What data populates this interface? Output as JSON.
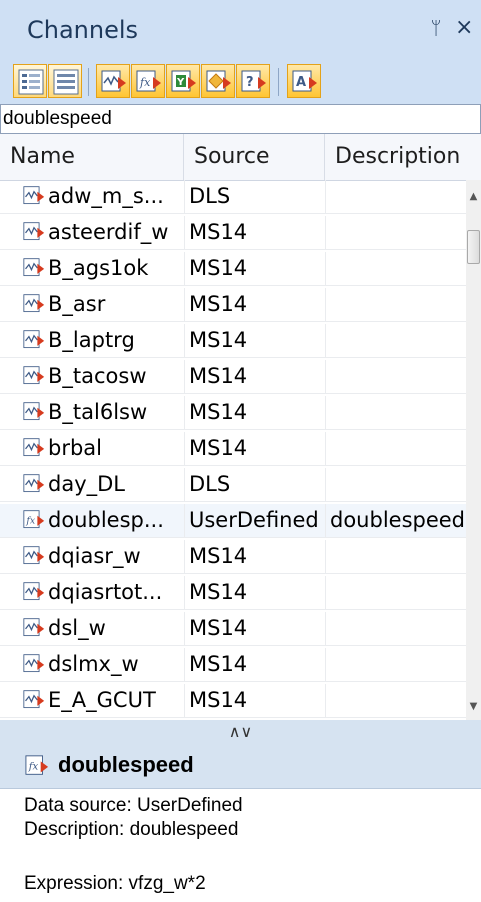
{
  "panel": {
    "title": "Channels",
    "pin_glyph": "ᛘ",
    "close_glyph": "×"
  },
  "toolbar": {
    "buttons": [
      {
        "name": "view-detail-button",
        "icon": "list-detail-icon"
      },
      {
        "name": "view-list-button",
        "icon": "list-icon"
      },
      {
        "name": "filter-measured-button",
        "icon": "measured-channel-icon"
      },
      {
        "name": "filter-userdefined-button",
        "icon": "fx-channel-icon"
      },
      {
        "name": "filter-calc-button",
        "icon": "calc-channel-icon"
      },
      {
        "name": "filter-bitfield-button",
        "icon": "diamond-channel-icon"
      },
      {
        "name": "filter-unknown-button",
        "icon": "question-channel-icon"
      },
      {
        "name": "filter-text-button",
        "icon": "text-channel-icon"
      }
    ]
  },
  "search": {
    "value": "doublespeed"
  },
  "columns": {
    "name": "Name",
    "source": "Source",
    "description": "Description"
  },
  "rows": [
    {
      "name": "adw_m_s...",
      "source": "DLS",
      "description": "",
      "icon": "measured-channel-icon"
    },
    {
      "name": "asteerdif_w",
      "source": "MS14",
      "description": "",
      "icon": "measured-channel-icon"
    },
    {
      "name": "B_ags1ok",
      "source": "MS14",
      "description": "",
      "icon": "measured-channel-icon"
    },
    {
      "name": "B_asr",
      "source": "MS14",
      "description": "",
      "icon": "measured-channel-icon"
    },
    {
      "name": "B_laptrg",
      "source": "MS14",
      "description": "",
      "icon": "measured-channel-icon"
    },
    {
      "name": "B_tacosw",
      "source": "MS14",
      "description": "",
      "icon": "measured-channel-icon"
    },
    {
      "name": "B_tal6lsw",
      "source": "MS14",
      "description": "",
      "icon": "measured-channel-icon"
    },
    {
      "name": "brbal",
      "source": "MS14",
      "description": "",
      "icon": "measured-channel-icon"
    },
    {
      "name": "day_DL",
      "source": "DLS",
      "description": "",
      "icon": "measured-channel-icon"
    },
    {
      "name": "doublesp...",
      "source": "UserDefined",
      "description": "doublespeed",
      "icon": "fx-channel-icon",
      "selected": true
    },
    {
      "name": "dqiasr_w",
      "source": "MS14",
      "description": "",
      "icon": "measured-channel-icon"
    },
    {
      "name": "dqiasrtot...",
      "source": "MS14",
      "description": "",
      "icon": "measured-channel-icon"
    },
    {
      "name": "dsl_w",
      "source": "MS14",
      "description": "",
      "icon": "measured-channel-icon"
    },
    {
      "name": "dslmx_w",
      "source": "MS14",
      "description": "",
      "icon": "measured-channel-icon"
    },
    {
      "name": "E_A_GCUT",
      "source": "MS14",
      "description": "",
      "icon": "measured-channel-icon"
    }
  ],
  "splitter": {
    "glyph": "∧∨"
  },
  "details": {
    "name": "doublespeed",
    "icon": "fx-channel-icon",
    "lines": [
      "Data source: UserDefined",
      "Description: doublespeed",
      "",
      "Expression: vfzg_w*2"
    ]
  }
}
